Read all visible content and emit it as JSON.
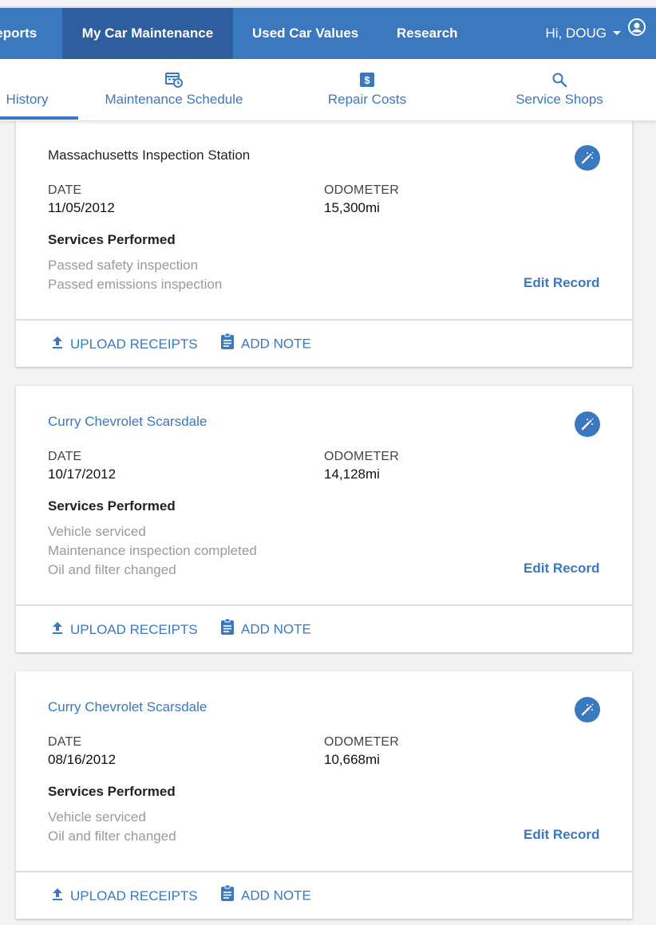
{
  "topnav": {
    "items": [
      {
        "label": "Reports"
      },
      {
        "label": "My Car Maintenance"
      },
      {
        "label": "Used Car Values"
      },
      {
        "label": "Research"
      }
    ],
    "user_greeting": "Hi, DOUG"
  },
  "subnav": {
    "tabs": [
      {
        "label": "History",
        "icon": "history-icon"
      },
      {
        "label": "Maintenance Schedule",
        "icon": "calendar-clock-icon"
      },
      {
        "label": "Repair Costs",
        "icon": "dollar-icon"
      },
      {
        "label": "Service Shops",
        "icon": "search-icon"
      }
    ],
    "active_tab": "History"
  },
  "records": [
    {
      "shop": "Massachusetts Inspection Station",
      "date_label": "DATE",
      "date": "11/05/2012",
      "odometer_label": "ODOMETER",
      "odometer": "15,300mi",
      "services_heading": "Services Performed",
      "services": [
        "Passed safety inspection",
        "Passed emissions inspection"
      ],
      "edit_label": "Edit Record",
      "upload_label": "UPLOAD RECEIPTS",
      "note_label": "ADD NOTE"
    },
    {
      "shop": "Curry Chevrolet Scarsdale",
      "date_label": "DATE",
      "date": "10/17/2012",
      "odometer_label": "ODOMETER",
      "odometer": "14,128mi",
      "services_heading": "Services Performed",
      "services": [
        "Vehicle serviced",
        "Maintenance inspection completed",
        "Oil and filter changed"
      ],
      "edit_label": "Edit Record",
      "upload_label": "UPLOAD RECEIPTS",
      "note_label": "ADD NOTE"
    },
    {
      "shop": "Curry Chevrolet Scarsdale",
      "date_label": "DATE",
      "date": "08/16/2012",
      "odometer_label": "ODOMETER",
      "odometer": "10,668mi",
      "services_heading": "Services Performed",
      "services": [
        "Vehicle serviced",
        "Oil and filter changed"
      ],
      "edit_label": "Edit Record",
      "upload_label": "UPLOAD RECEIPTS",
      "note_label": "ADD NOTE"
    }
  ],
  "colors": {
    "brand_blue": "#3a78bf",
    "active_nav": "#2d5f9e",
    "muted_text": "#9a9a9a"
  }
}
